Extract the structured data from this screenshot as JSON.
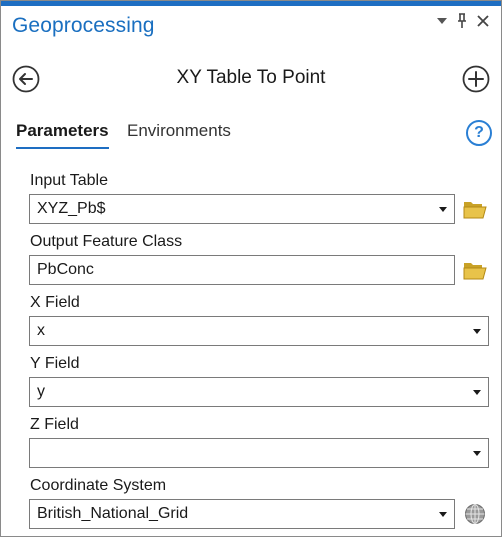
{
  "pane": {
    "title": "Geoprocessing",
    "accent_color": "#1e6ec2"
  },
  "title_controls": {
    "menu_icon": "dropdown-triangle-icon",
    "pin_icon": "pin-icon",
    "close_icon": "close-icon"
  },
  "tool": {
    "title": "XY Table To Point",
    "back_icon": "back-arrow-circle-icon",
    "add_icon": "add-circle-icon"
  },
  "tabs": [
    {
      "label": "Parameters",
      "active": true
    },
    {
      "label": "Environments",
      "active": false
    }
  ],
  "help": {
    "glyph": "?"
  },
  "params": {
    "input_table": {
      "label": "Input Table",
      "value": "XYZ_Pb$",
      "has_dropdown": true,
      "side_icon": "folder-icon"
    },
    "output_feature_class": {
      "label": "Output Feature Class",
      "value": "PbConc",
      "has_dropdown": false,
      "side_icon": "folder-icon"
    },
    "x_field": {
      "label": "X Field",
      "value": "x",
      "has_dropdown": true
    },
    "y_field": {
      "label": "Y Field",
      "value": "y",
      "has_dropdown": true
    },
    "z_field": {
      "label": "Z Field",
      "value": "",
      "has_dropdown": true
    },
    "coordinate_system": {
      "label": "Coordinate System",
      "value": "British_National_Grid",
      "has_dropdown": true,
      "side_icon": "globe-icon"
    }
  }
}
